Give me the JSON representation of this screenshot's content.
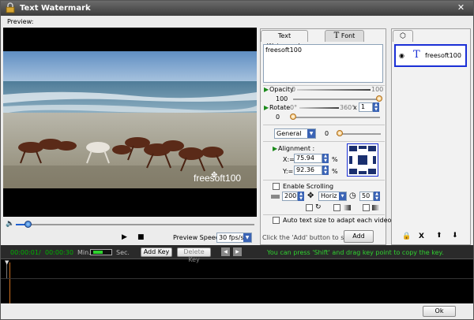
{
  "window": {
    "title": "Text Watermark",
    "close_glyph": "✕"
  },
  "preview": {
    "label": "Preview:",
    "overlay_text": "freesoft100",
    "speed_label": "Preview Speed:",
    "speed_value": "30 fps/s",
    "seek_position": 0.05
  },
  "tabs": {
    "text_watermark": "Text Watermark",
    "font": "Font",
    "font_glyph": "T"
  },
  "text_editor": {
    "value": "freesoft100"
  },
  "opacity": {
    "label": "Opacity",
    "min": "0",
    "max": "100",
    "value": "100"
  },
  "rotate": {
    "label": "Rotate",
    "min": "0°",
    "max": "360°",
    "multiplier": "x",
    "multiplier_value": "1",
    "value": "0"
  },
  "mode": {
    "select_value": "General",
    "value": "0"
  },
  "alignment": {
    "label": "Alignment :",
    "x_label": "X:=",
    "x_value": "75.94",
    "y_label": "Y:=",
    "y_value": "92.36",
    "unit": "%"
  },
  "scrolling": {
    "label": "Enable Scrolling",
    "speed": "200",
    "direction": "Horiz",
    "time": "50"
  },
  "auto_size": {
    "label": "Auto text size to adapt each videos."
  },
  "add": {
    "hint": "Click the 'Add' button to start ->",
    "button": "Add"
  },
  "watermark_list": {
    "items": [
      {
        "label": "freesoft100",
        "glyph": "T"
      }
    ]
  },
  "list_actions": {
    "delete": "X"
  },
  "timeline": {
    "current_time": "00:00:01",
    "separator": "/",
    "total_time": "00:00:30",
    "min_label": "Min.",
    "sec_label": "Sec.",
    "add_key": "Add Key",
    "delete_key": "Delete Key",
    "hint": "You can press 'Shift' and drag key point to copy the key."
  },
  "ok_button": "Ok",
  "colors": {
    "accent_blue": "#1a2fd6",
    "hint_green": "#2fd22f",
    "time_green": "#00b000"
  }
}
